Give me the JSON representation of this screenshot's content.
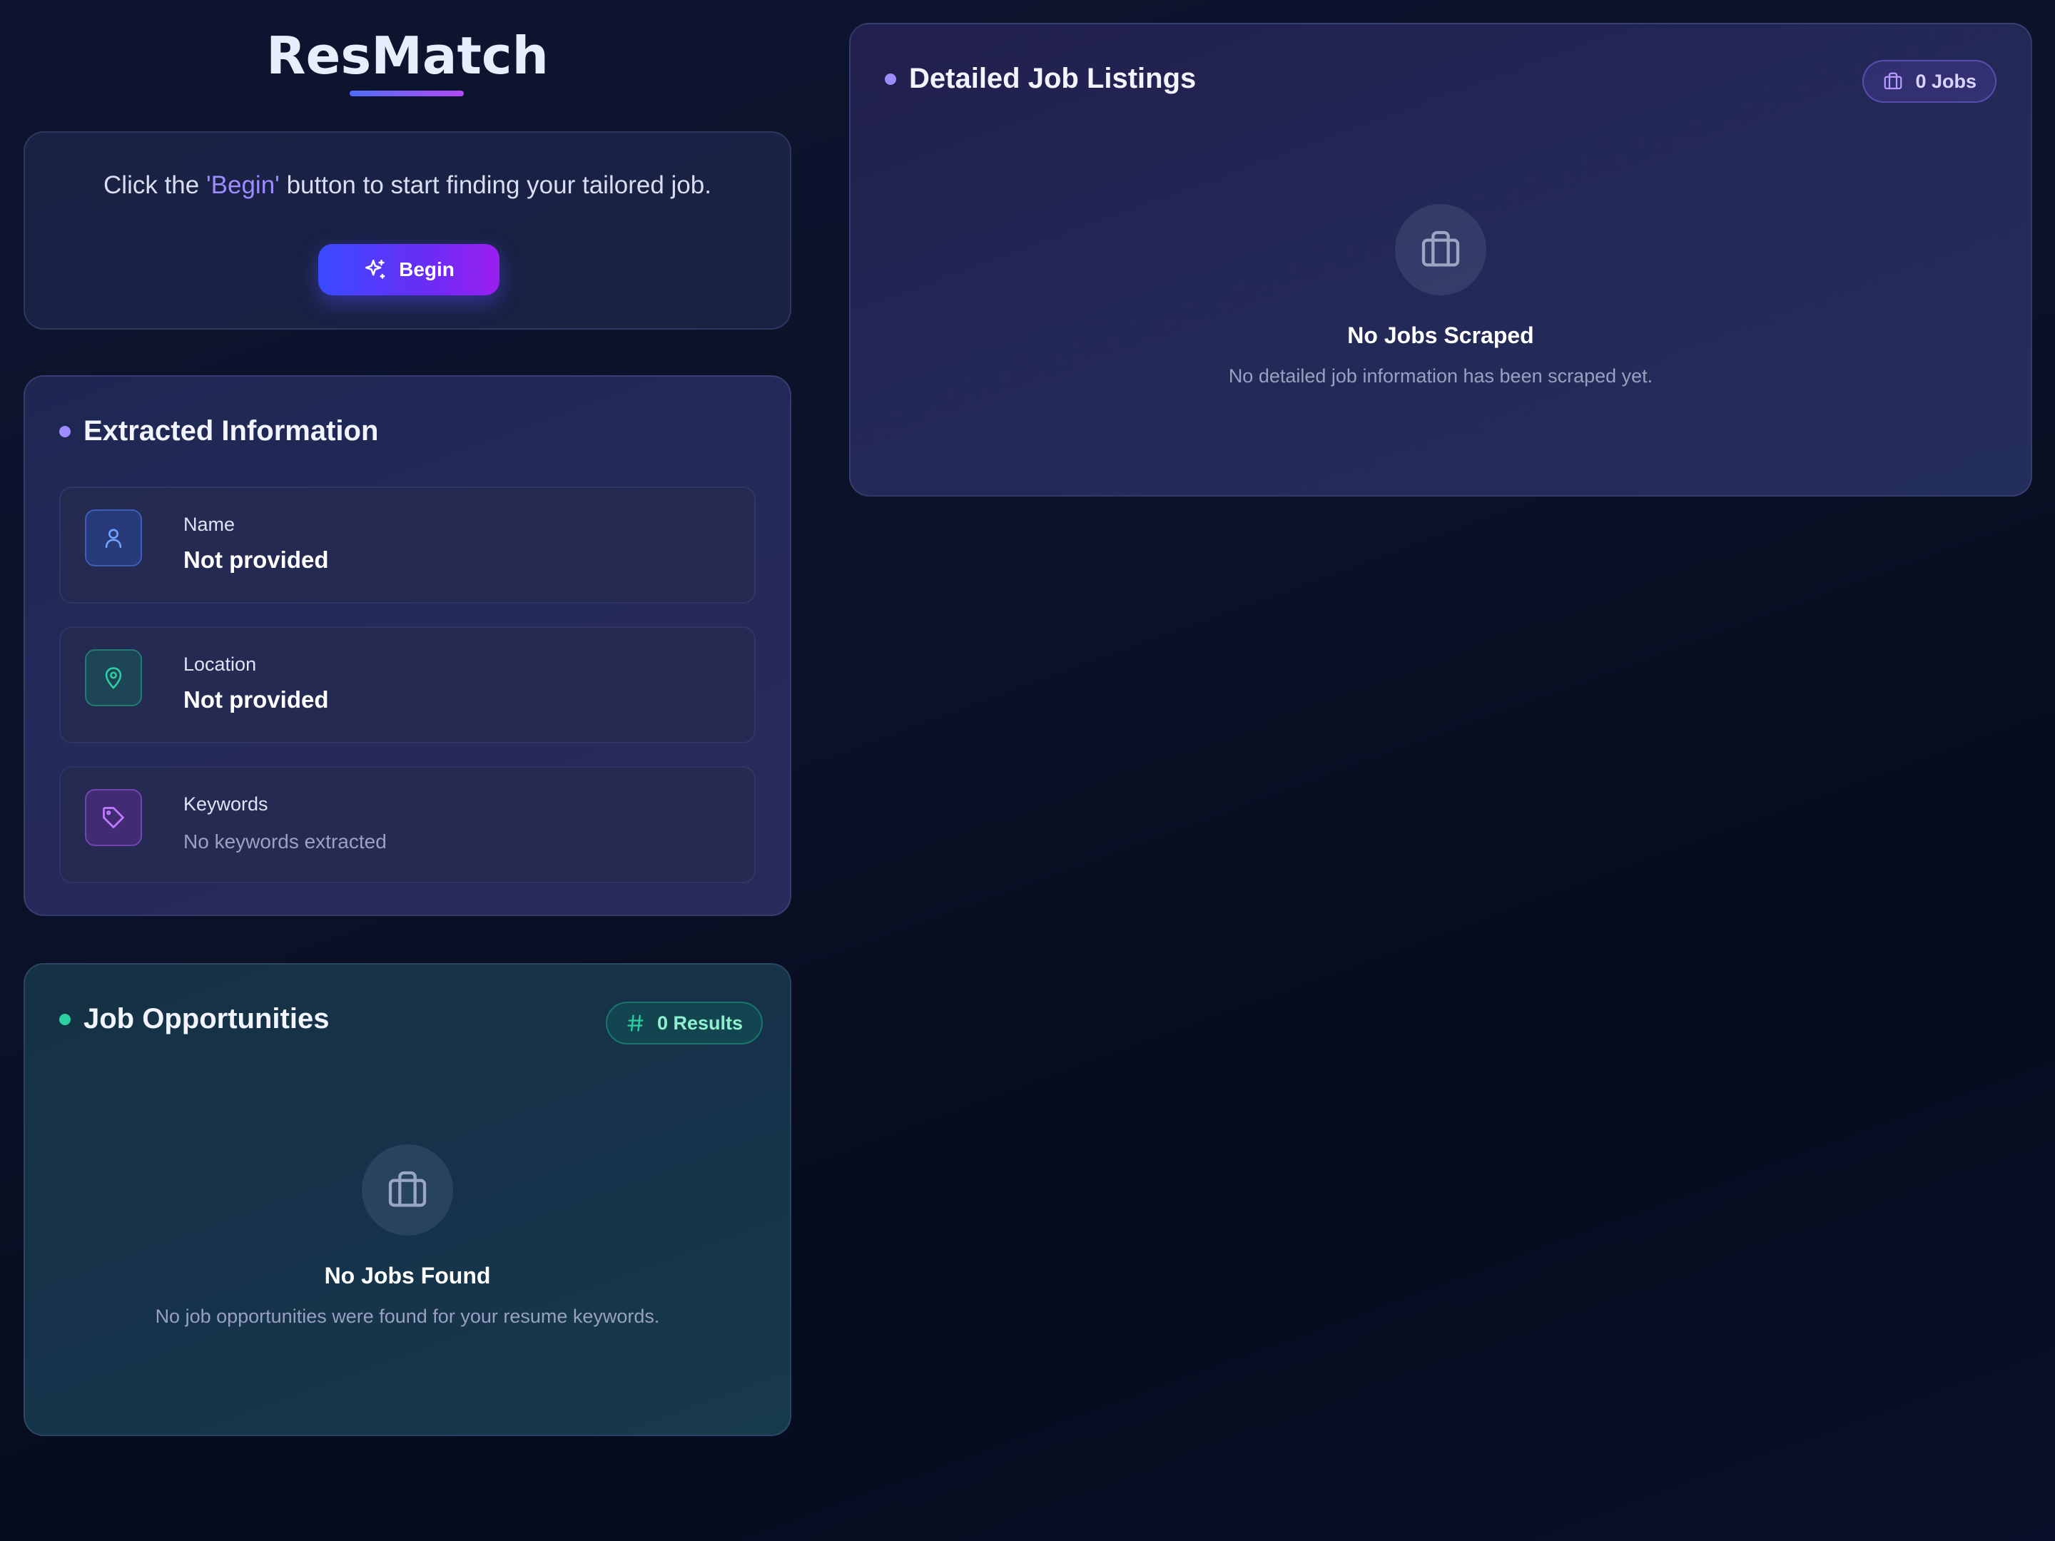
{
  "header": {
    "app_title": "ResMatch"
  },
  "intro": {
    "text_before": "Click the ",
    "highlight": "'Begin'",
    "text_after": " button to start finding your tailored job.",
    "begin_button_label": "Begin"
  },
  "extracted": {
    "title": "Extracted Information",
    "items": [
      {
        "label": "Name",
        "value": "Not provided",
        "icon": "user-icon"
      },
      {
        "label": "Location",
        "value": "Not provided",
        "icon": "map-pin-icon"
      },
      {
        "label": "Keywords",
        "value": "No keywords extracted",
        "icon": "tag-icon"
      }
    ]
  },
  "opportunities": {
    "title": "Job Opportunities",
    "badge_label": "0 Results",
    "empty_title": "No Jobs Found",
    "empty_text": "No job opportunities were found for your resume keywords."
  },
  "listings": {
    "title": "Detailed Job Listings",
    "badge_label": "0 Jobs",
    "empty_title": "No Jobs Scraped",
    "empty_text": "No detailed job information has been scraped yet."
  },
  "colors": {
    "accent_purple": "#9d8bff",
    "accent_green": "#2ad1a0",
    "button_gradient_start": "#3a4bff",
    "button_gradient_end": "#9a1ff0"
  }
}
